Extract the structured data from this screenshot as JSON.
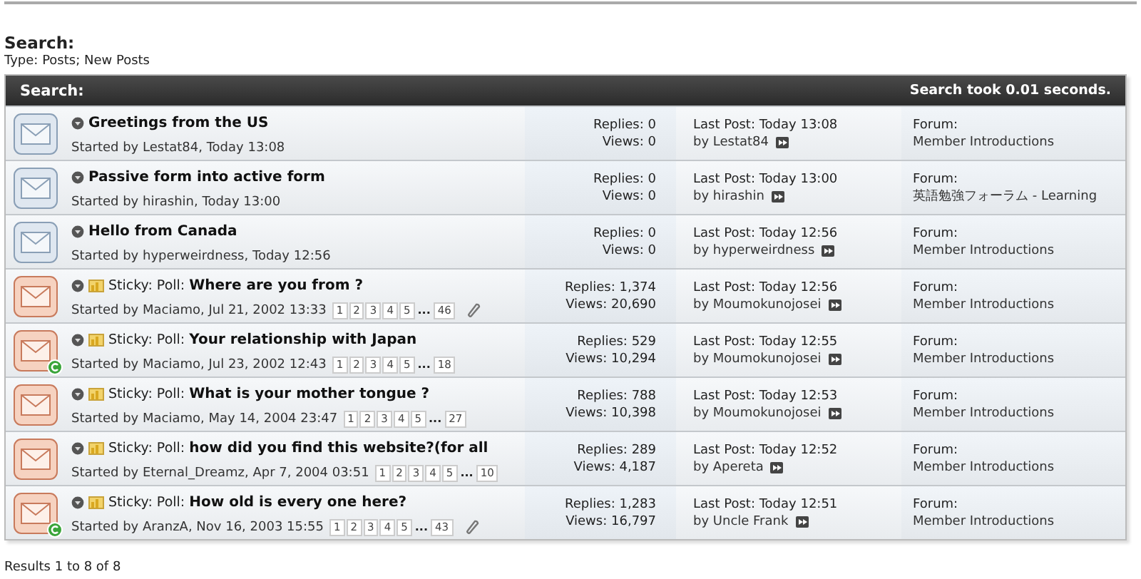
{
  "page_title": "Search:",
  "subtitle": "Type: Posts; New Posts",
  "table": {
    "title": "Search:",
    "timing": "Search took 0.01 seconds.",
    "rows": [
      {
        "kind": "new",
        "title": "Greetings from the US",
        "starter": "Started by Lestat84, Today 13:08",
        "attachment": false,
        "posted": false,
        "replies": "Replies: 0",
        "views": "Views: 0",
        "last_post": "Last Post: Today 13:08",
        "last_by": "by Lestat84",
        "forum_label": "Forum:",
        "forum": "Member Introductions"
      },
      {
        "kind": "new",
        "title": "Passive form into active form",
        "starter": "Started by hirashin, Today 13:00",
        "attachment": false,
        "posted": false,
        "replies": "Replies: 0",
        "views": "Views: 0",
        "last_post": "Last Post: Today 13:00",
        "last_by": "by hirashin",
        "forum_label": "Forum:",
        "forum": "英語勉強フォーラム - Learning"
      },
      {
        "kind": "new",
        "title": "Hello from Canada",
        "starter": "Started by hyperweirdness, Today 12:56",
        "attachment": false,
        "posted": false,
        "replies": "Replies: 0",
        "views": "Views: 0",
        "last_post": "Last Post: Today 12:56",
        "last_by": "by hyperweirdness",
        "forum_label": "Forum:",
        "forum": "Member Introductions"
      },
      {
        "kind": "sticky",
        "prefix": "Sticky: Poll:",
        "title": "Where are you from ?",
        "starter": "Started by Maciamo, Jul 21, 2002 13:33",
        "pages": [
          "1",
          "2",
          "3",
          "4",
          "5"
        ],
        "more": "...",
        "last_page": "46",
        "attachment": true,
        "posted": false,
        "replies": "Replies: 1,374",
        "views": "Views: 20,690",
        "last_post": "Last Post: Today 12:56",
        "last_by": "by Moumokunojosei",
        "forum_label": "Forum:",
        "forum": "Member Introductions"
      },
      {
        "kind": "sticky",
        "prefix": "Sticky: Poll:",
        "title": "Your relationship with Japan",
        "starter": "Started by Maciamo, Jul 23, 2002 12:43",
        "pages": [
          "1",
          "2",
          "3",
          "4",
          "5"
        ],
        "more": "...",
        "last_page": "18",
        "attachment": false,
        "posted": true,
        "replies": "Replies: 529",
        "views": "Views: 10,294",
        "last_post": "Last Post: Today 12:55",
        "last_by": "by Moumokunojosei",
        "forum_label": "Forum:",
        "forum": "Member Introductions"
      },
      {
        "kind": "sticky",
        "prefix": "Sticky: Poll:",
        "title": "What is your mother tongue ?",
        "starter": "Started by Maciamo, May 14, 2004 23:47",
        "pages": [
          "1",
          "2",
          "3",
          "4",
          "5"
        ],
        "more": "...",
        "last_page": "27",
        "attachment": false,
        "posted": false,
        "replies": "Replies: 788",
        "views": "Views: 10,398",
        "last_post": "Last Post: Today 12:53",
        "last_by": "by Moumokunojosei",
        "forum_label": "Forum:",
        "forum": "Member Introductions"
      },
      {
        "kind": "sticky",
        "prefix": "Sticky: Poll:",
        "title": "how did you find this website?(for all",
        "starter": "Started by Eternal_Dreamz, Apr 7, 2004 03:51",
        "pages": [
          "1",
          "2",
          "3",
          "4",
          "5"
        ],
        "more": "...",
        "last_page": "10",
        "attachment": false,
        "posted": false,
        "replies": "Replies: 289",
        "views": "Views: 4,187",
        "last_post": "Last Post: Today 12:52",
        "last_by": "by Apereta",
        "forum_label": "Forum:",
        "forum": "Member Introductions"
      },
      {
        "kind": "sticky",
        "prefix": "Sticky: Poll:",
        "title": "How old is every one here?",
        "starter": "Started by AranzA, Nov 16, 2003 15:55",
        "pages": [
          "1",
          "2",
          "3",
          "4",
          "5"
        ],
        "more": "...",
        "last_page": "43",
        "attachment": true,
        "posted": true,
        "replies": "Replies: 1,283",
        "views": "Views: 16,797",
        "last_post": "Last Post: Today 12:51",
        "last_by": "by Uncle Frank",
        "forum_label": "Forum:",
        "forum": "Member Introductions"
      }
    ]
  },
  "results": "Results 1 to 8 of 8"
}
